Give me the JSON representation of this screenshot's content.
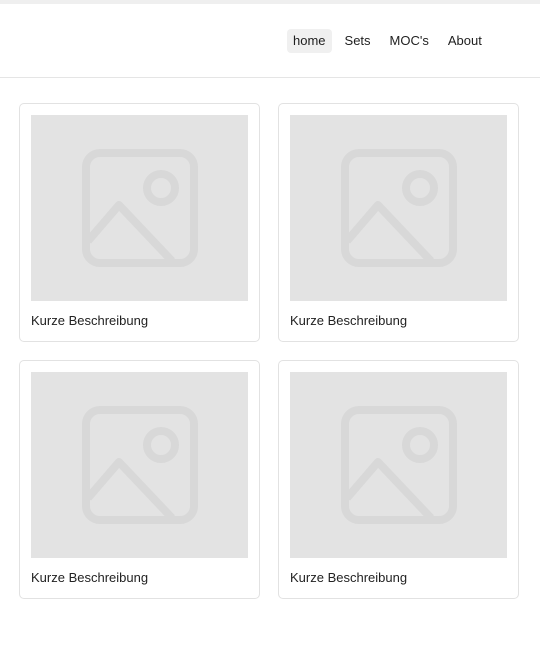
{
  "nav": {
    "items": [
      {
        "label": "home",
        "active": true
      },
      {
        "label": "Sets",
        "active": false
      },
      {
        "label": "MOC's",
        "active": false
      },
      {
        "label": "About",
        "active": false
      }
    ]
  },
  "cards": [
    {
      "caption": "Kurze Beschreibung",
      "icon": "image-placeholder-icon"
    },
    {
      "caption": "Kurze Beschreibung",
      "icon": "image-placeholder-icon"
    },
    {
      "caption": "Kurze Beschreibung",
      "icon": "image-placeholder-icon"
    },
    {
      "caption": "Kurze Beschreibung",
      "icon": "image-placeholder-icon"
    }
  ],
  "colors": {
    "placeholder_bg": "#e3e3e3",
    "placeholder_icon": "#d8d8d8",
    "card_border": "#e2e2e2",
    "active_nav_bg": "#f0f0f0"
  }
}
